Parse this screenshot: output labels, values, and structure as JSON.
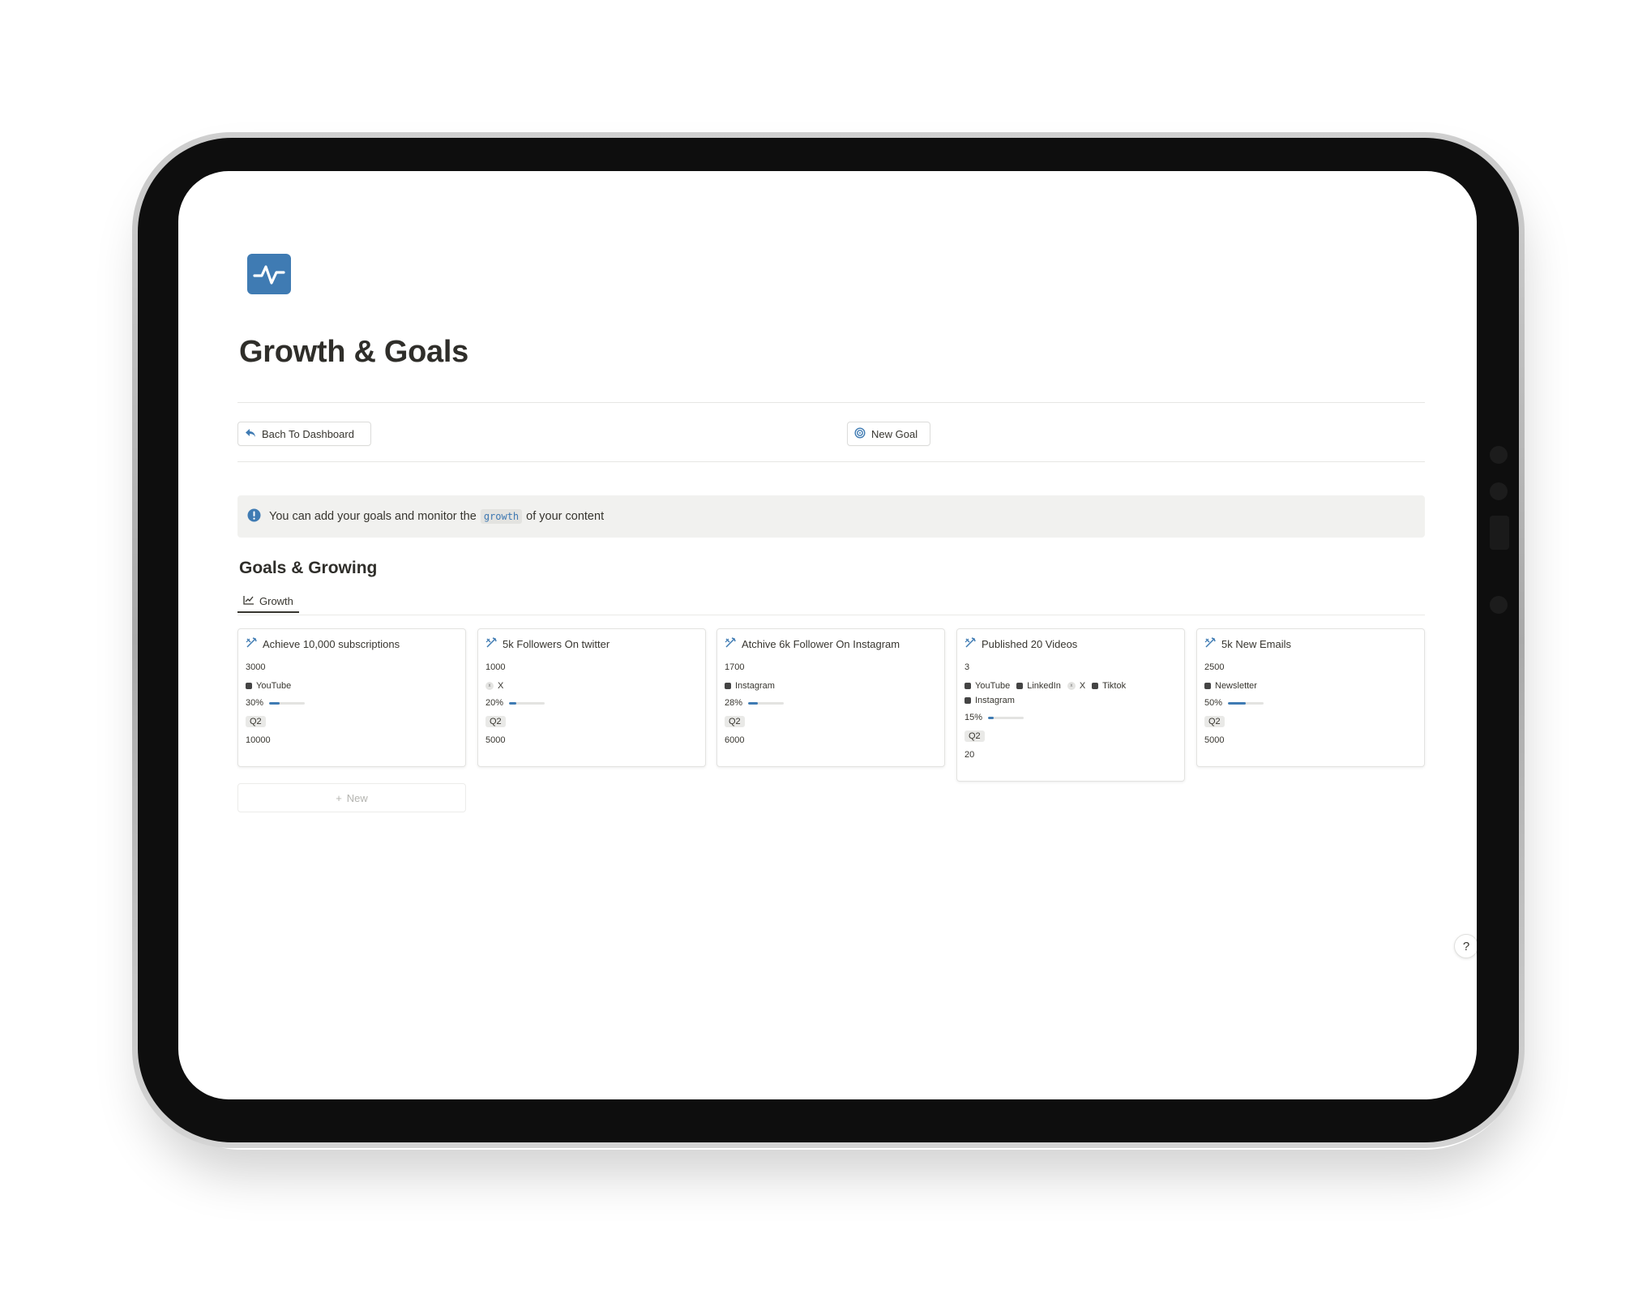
{
  "page": {
    "title": "Growth & Goals",
    "icon": "activity-pulse-icon",
    "accent": "#3f7bb3"
  },
  "toolbar": {
    "back_label": "Bach To Dashboard",
    "back_icon": "back-arrow-icon",
    "new_goal_label": "New Goal",
    "new_goal_icon": "target-icon"
  },
  "callout": {
    "icon": "exclamation-circle-icon",
    "text_before": "You can add your goals and monitor the",
    "code": "growth",
    "text_after": "of your content"
  },
  "section": {
    "title": "Goals & Growing",
    "tab_label": "Growth",
    "tab_icon": "line-chart-icon"
  },
  "cards": [
    {
      "title": "Achieve 10,000 subscriptions",
      "current": "3000",
      "platforms": [
        {
          "name": "YouTube",
          "icon": "square"
        }
      ],
      "progress_label": "30%",
      "progress": 0.3,
      "quarter": "Q2",
      "target": "10000"
    },
    {
      "title": "5k Followers On twitter",
      "current": "1000",
      "platforms": [
        {
          "name": "X",
          "icon": "x"
        }
      ],
      "progress_label": "20%",
      "progress": 0.2,
      "quarter": "Q2",
      "target": "5000"
    },
    {
      "title": "Atchive 6k Follower On Instagram",
      "current": "1700",
      "platforms": [
        {
          "name": "Instagram",
          "icon": "square"
        }
      ],
      "progress_label": "28%",
      "progress": 0.28,
      "quarter": "Q2",
      "target": "6000"
    },
    {
      "title": "Published 20 Videos",
      "current": "3",
      "platforms": [
        {
          "name": "YouTube",
          "icon": "square"
        },
        {
          "name": "LinkedIn",
          "icon": "square"
        },
        {
          "name": "X",
          "icon": "x"
        },
        {
          "name": "Tiktok",
          "icon": "square"
        },
        {
          "name": "Instagram",
          "icon": "square"
        }
      ],
      "progress_label": "15%",
      "progress": 0.15,
      "quarter": "Q2",
      "target": "20"
    },
    {
      "title": "5k New Emails",
      "current": "2500",
      "platforms": [
        {
          "name": "Newsletter",
          "icon": "square"
        }
      ],
      "progress_label": "50%",
      "progress": 0.5,
      "quarter": "Q2",
      "target": "5000"
    }
  ],
  "new_row_label": "New",
  "help_label": "?"
}
